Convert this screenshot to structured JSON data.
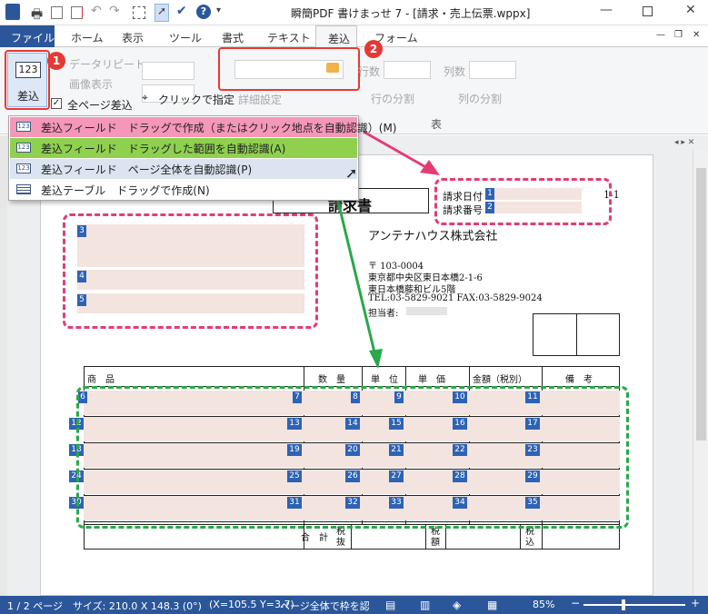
{
  "title_bar": {
    "title": "瞬簡PDF 書けまっせ 7 - [請求・売上伝票.wppx]",
    "quick_access": [
      "app-icon",
      "print-icon",
      "save-icon",
      "save-as-icon",
      "undo-icon",
      "redo-icon",
      "select-icon",
      "pointer-icon",
      "check-icon",
      "help-icon",
      "dropdown-icon"
    ]
  },
  "tabs": {
    "file": "ファイル",
    "home": "ホーム",
    "view": "表示",
    "tool": "ツール",
    "format": "書式",
    "text": "テキスト",
    "sashikomi": "差込",
    "form": "フォーム"
  },
  "ribbon": {
    "sashikomi_button": "差込",
    "sashikomi_icon_text": "123",
    "data_repeat": "データリピート",
    "image_display": "画像表示",
    "all_pages": "全ページ差込",
    "click_specify": "クリックで指定",
    "detail_settings": "詳細設定",
    "rows": "行数",
    "cols": "列数",
    "split_rows": "行の分割",
    "split_cols": "列の分割",
    "table_group": "表",
    "field_input_value": ""
  },
  "badges": {
    "one": "1",
    "two": "2"
  },
  "dropdown": {
    "items": [
      {
        "label": "差込フィールド　ドラッグで作成（またはクリック地点を自動認識）(M)",
        "color": "#f597b8"
      },
      {
        "label": "差込フィールド　ドラッグした範囲を自動認識(A)",
        "color": "#8fd14f"
      },
      {
        "label": "差込フィールド　ページ全体を自動認識(P)",
        "color": "#dbe4f0"
      },
      {
        "label": "差込テーブル　ドラッグで作成(N)",
        "color": "#ffffff"
      }
    ]
  },
  "document": {
    "title": "請求書",
    "invoice_date_label": "請求日付",
    "invoice_no_label": "請求番号",
    "page_num": "1-1",
    "company": "アンテナハウス株式会社",
    "postal": "〒 103-0004",
    "address1": "東京都中央区東日本橋2-1-6",
    "address2": "東日本橋藤和ビル5階",
    "phone": "TEL:03-5829-9021  FAX:03-5829-9024",
    "person": "担当者:",
    "columns": [
      "商　品",
      "数　量",
      "単　位",
      "単　価",
      "金額（税別）",
      "備　考"
    ],
    "footer_total": "合　計",
    "footer_tax_excl": "税抜",
    "footer_tax": "税額",
    "footer_tax_incl": "税込",
    "field_numbers": {
      "header": [
        "1",
        "2"
      ],
      "address": [
        "3",
        "4",
        "5"
      ],
      "rows": [
        [
          "6",
          "7",
          "8",
          "9",
          "10",
          "11"
        ],
        [
          "12",
          "13",
          "14",
          "15",
          "16",
          "17"
        ],
        [
          "18",
          "19",
          "20",
          "21",
          "22",
          "23"
        ],
        [
          "24",
          "25",
          "26",
          "27",
          "28",
          "29"
        ],
        [
          "30",
          "31",
          "32",
          "33",
          "34",
          "35"
        ]
      ]
    }
  },
  "status": {
    "page": "1 / 2 ページ",
    "size": "サイズ: 210.0 X 148.3 (0°)",
    "coords": "(X=105.5 Y=3.7)",
    "message": "ページ全体で枠を認識",
    "zoom": "85%"
  },
  "colors": {
    "accent": "#2b579a",
    "pink": "#e43c74",
    "green": "#2aa84a",
    "red": "#e53935",
    "field_fill": "#f3e4df",
    "field_num": "#2d63b5"
  }
}
